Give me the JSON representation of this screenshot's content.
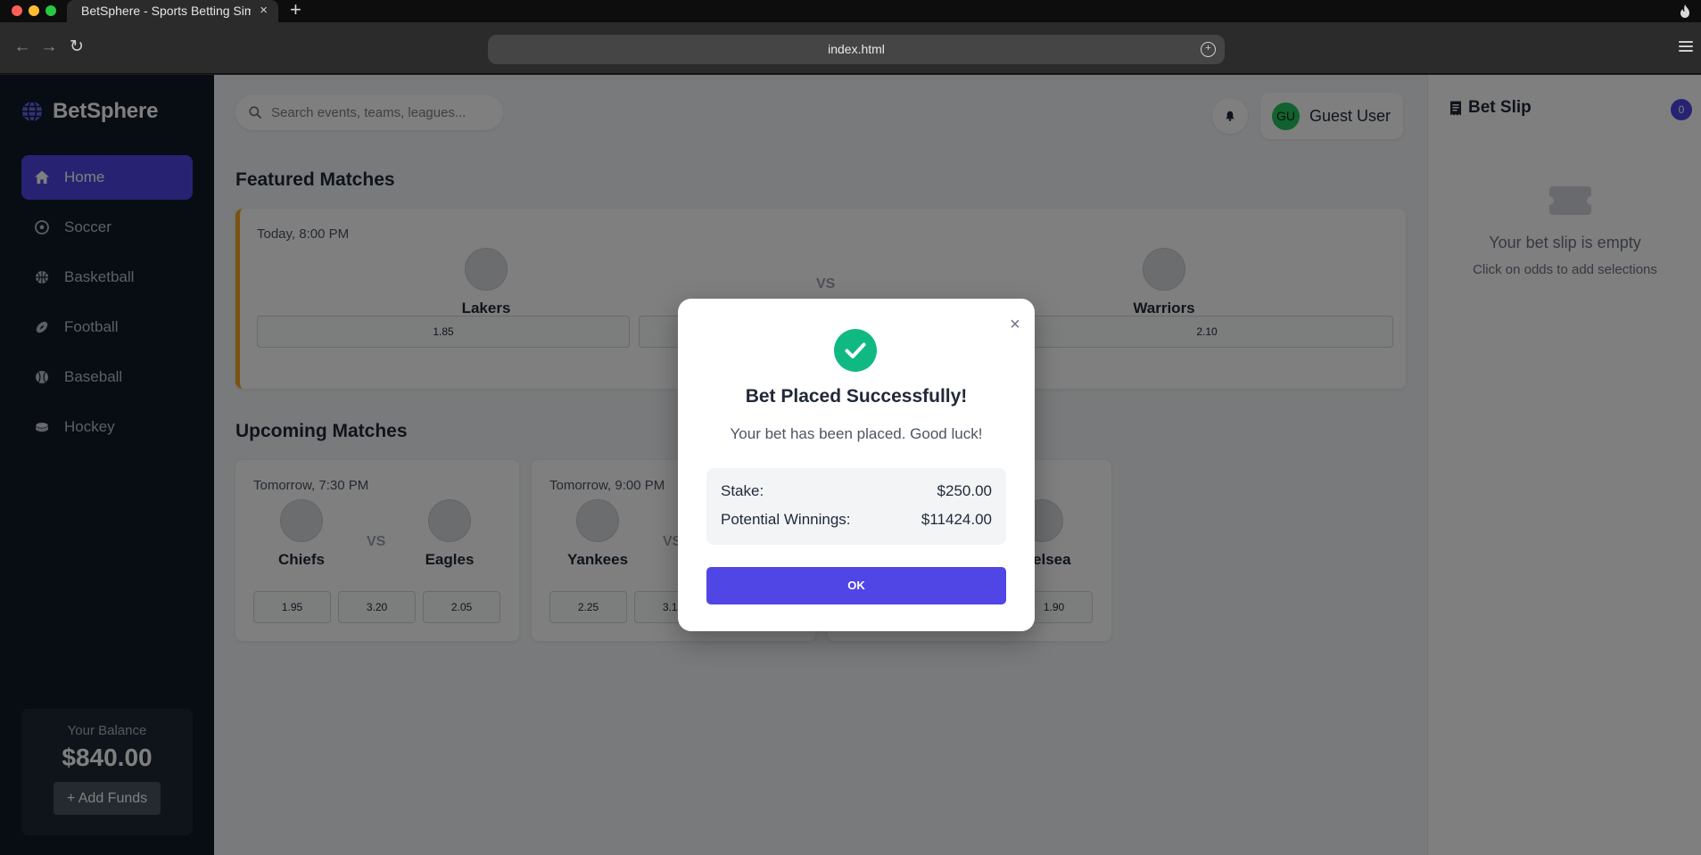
{
  "browser": {
    "tab_title": "BetSphere - Sports Betting Simu",
    "tab_close": "×",
    "new_tab": "+",
    "url": "index.html",
    "back": "←",
    "forward": "→",
    "reload": "↻"
  },
  "sidebar": {
    "logo_text": "BetSphere",
    "items": [
      {
        "label": "Home",
        "icon": "home-icon",
        "active": true
      },
      {
        "label": "Soccer",
        "icon": "soccer-ball-icon"
      },
      {
        "label": "Basketball",
        "icon": "basketball-icon"
      },
      {
        "label": "Football",
        "icon": "football-icon"
      },
      {
        "label": "Baseball",
        "icon": "baseball-icon"
      },
      {
        "label": "Hockey",
        "icon": "hockey-puck-icon"
      }
    ],
    "balance_label": "Your Balance",
    "balance_amount": "$840.00",
    "add_funds_label": "+ Add Funds"
  },
  "header": {
    "search_placeholder": "Search events, teams, leagues...",
    "user_initials": "GU",
    "user_name": "Guest User"
  },
  "featured": {
    "title": "Featured Matches",
    "match": {
      "time": "Today, 8:00 PM",
      "home": "Lakers",
      "away": "Warriors",
      "vs": "VS",
      "odds": [
        "1.85",
        "",
        "2.10"
      ]
    }
  },
  "upcoming": {
    "title": "Upcoming Matches",
    "matches": [
      {
        "time": "Tomorrow, 7:30 PM",
        "home": "Chiefs",
        "away": "Eagles",
        "vs": "VS",
        "odds": [
          "1.95",
          "3.20",
          "2.05"
        ]
      },
      {
        "time": "Tomorrow, 9:00 PM",
        "home": "Yankees",
        "away": "",
        "vs": "VS",
        "odds": [
          "2.25",
          "3.10",
          ""
        ]
      },
      {
        "time": "",
        "home": "",
        "away": "Chelsea",
        "vs": "",
        "odds": [
          "",
          "",
          "1.90"
        ]
      }
    ]
  },
  "betslip": {
    "title": "Bet Slip",
    "count": "0",
    "empty_text": "Your bet slip is empty",
    "hint_text": "Click on odds to add selections"
  },
  "modal": {
    "close": "×",
    "title": "Bet Placed Successfully!",
    "message": "Your bet has been placed. Good luck!",
    "stake_label": "Stake:",
    "stake_value": "$250.00",
    "winnings_label": "Potential Winnings:",
    "winnings_value": "$11424.00",
    "ok_label": "OK"
  },
  "colors": {
    "accent": "#4f46e5",
    "success": "#10b981",
    "featured_border": "#f5a623",
    "sidebar_bg": "#111827"
  }
}
